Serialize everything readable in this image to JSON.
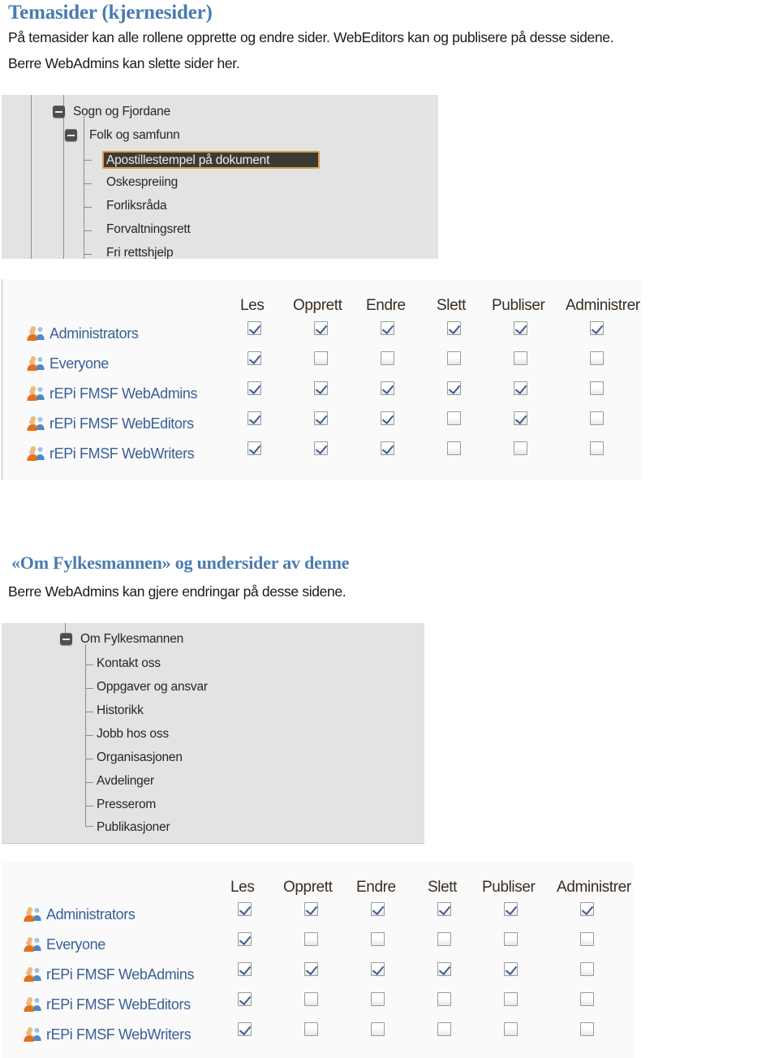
{
  "document": {
    "sections": [
      {
        "heading": "Temasider (kjernesider)",
        "paragraphs": [
          "På temasider kan alle rollene opprette og endre sider. WebEditors kan og publisere på desse sidene.",
          "Berre WebAdmins kan slette sider her."
        ]
      },
      {
        "heading": "«Om Fylkesmannen» og undersider av denne",
        "paragraphs": [
          "Berre WebAdmins kan gjere endringar på desse sidene."
        ]
      }
    ]
  },
  "colors": {
    "heading": "#4a7bb0",
    "body_text": "#1b1b1b",
    "tree_background": "#e3e3e3",
    "table_background": "#fafafa",
    "selection_background": "#3d3a36",
    "selection_border": "#d4a24a",
    "group_label": "#3a5f96",
    "checkbox_check": "#3c5d93"
  },
  "tree_1": {
    "nodes": [
      {
        "label": "Sogn og Fjordane",
        "depth": 0,
        "expander": "collapse-minus",
        "selected": false
      },
      {
        "label": "Folk og samfunn",
        "depth": 1,
        "expander": "collapse-minus",
        "selected": false
      },
      {
        "label": "Apostillestempel på dokument",
        "depth": 2,
        "expander": "none",
        "selected": true
      },
      {
        "label": "Oskespreiing",
        "depth": 2,
        "expander": "none",
        "selected": false
      },
      {
        "label": "Forliksråda",
        "depth": 2,
        "expander": "none",
        "selected": false
      },
      {
        "label": "Forvaltningsrett",
        "depth": 2,
        "expander": "none",
        "selected": false
      },
      {
        "label": "Fri rettshjelp",
        "depth": 2,
        "expander": "none",
        "selected": false
      }
    ]
  },
  "tree_2": {
    "nodes": [
      {
        "label": "Om Fylkesmannen",
        "depth": 0,
        "expander": "collapse-minus",
        "selected": false
      },
      {
        "label": "Kontakt oss",
        "depth": 1,
        "expander": "none",
        "selected": false
      },
      {
        "label": "Oppgaver og ansvar",
        "depth": 1,
        "expander": "none",
        "selected": false
      },
      {
        "label": "Historikk",
        "depth": 1,
        "expander": "none",
        "selected": false
      },
      {
        "label": "Jobb hos oss",
        "depth": 1,
        "expander": "none",
        "selected": false
      },
      {
        "label": "Organisasjonen",
        "depth": 1,
        "expander": "none",
        "selected": false
      },
      {
        "label": "Avdelinger",
        "depth": 1,
        "expander": "none",
        "selected": false
      },
      {
        "label": "Presserom",
        "depth": 1,
        "expander": "none",
        "selected": false
      },
      {
        "label": "Publikasjoner",
        "depth": 1,
        "expander": "none",
        "selected": false
      }
    ]
  },
  "permission_table_1": {
    "columns": [
      "Les",
      "Opprett",
      "Endre",
      "Slett",
      "Publiser",
      "Administrer"
    ],
    "rows": [
      {
        "group": "Administrators",
        "icon": "user-group-icon",
        "values": [
          true,
          true,
          true,
          true,
          true,
          true
        ]
      },
      {
        "group": "Everyone",
        "icon": "user-group-icon",
        "values": [
          true,
          false,
          false,
          false,
          false,
          false
        ]
      },
      {
        "group": "rEPi FMSF WebAdmins",
        "icon": "user-group-icon",
        "values": [
          true,
          true,
          true,
          true,
          true,
          false
        ]
      },
      {
        "group": "rEPi FMSF WebEditors",
        "icon": "user-group-icon",
        "values": [
          true,
          true,
          true,
          false,
          true,
          false
        ]
      },
      {
        "group": "rEPi FMSF WebWriters",
        "icon": "user-group-icon",
        "values": [
          true,
          true,
          true,
          false,
          false,
          false
        ]
      }
    ]
  },
  "permission_table_2": {
    "columns": [
      "Les",
      "Opprett",
      "Endre",
      "Slett",
      "Publiser",
      "Administrer"
    ],
    "rows": [
      {
        "group": "Administrators",
        "icon": "user-group-icon",
        "values": [
          true,
          true,
          true,
          true,
          true,
          true
        ]
      },
      {
        "group": "Everyone",
        "icon": "user-group-icon",
        "values": [
          true,
          false,
          false,
          false,
          false,
          false
        ]
      },
      {
        "group": "rEPi FMSF WebAdmins",
        "icon": "user-group-icon",
        "values": [
          true,
          true,
          true,
          true,
          true,
          false
        ]
      },
      {
        "group": "rEPi FMSF WebEditors",
        "icon": "user-group-icon",
        "values": [
          true,
          false,
          false,
          false,
          false,
          false
        ]
      },
      {
        "group": "rEPi FMSF WebWriters",
        "icon": "user-group-icon",
        "values": [
          true,
          false,
          false,
          false,
          false,
          false
        ]
      }
    ]
  }
}
